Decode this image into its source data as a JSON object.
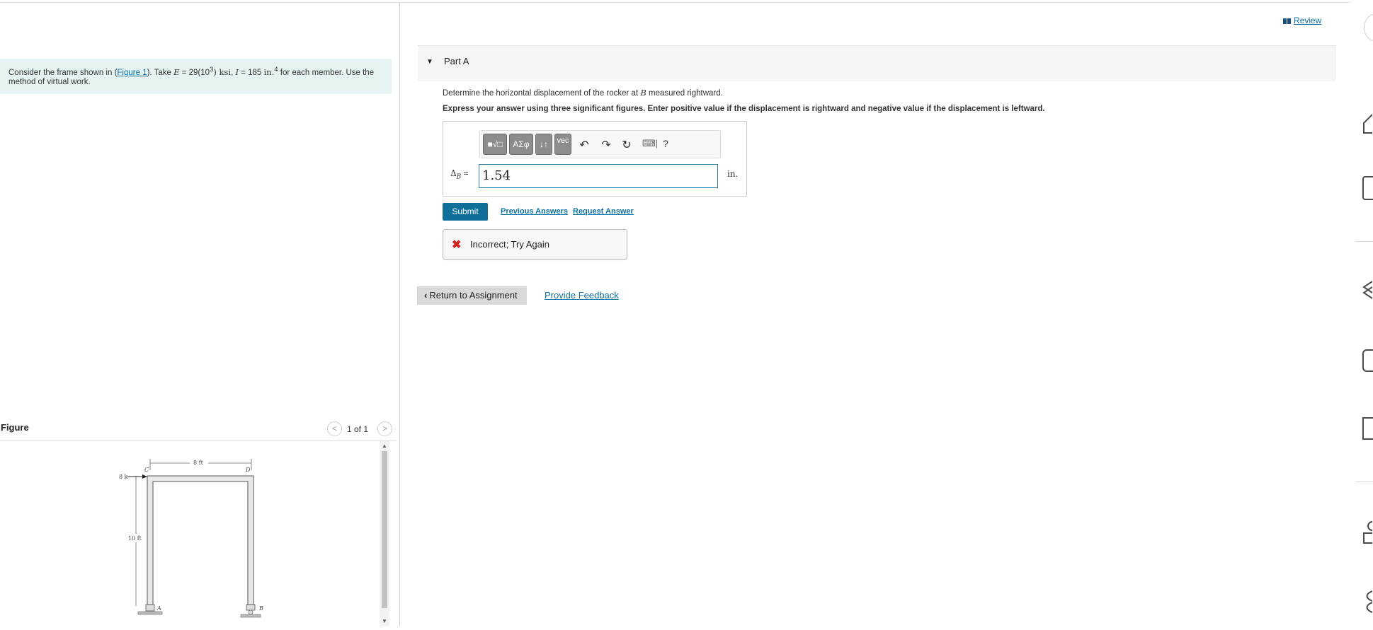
{
  "review": {
    "label": "Review"
  },
  "problem": {
    "prefix": "Consider the frame shown in (",
    "figure_link": "Figure 1",
    "middle": "). Take ",
    "e_symbol": "E",
    "e_value": " = 29(10",
    "e_exp": "3",
    "e_unit": ") ksi",
    "sep": ", ",
    "i_symbol": "I",
    "i_value": " = 185 ",
    "i_unit": "in.",
    "i_exp": "4",
    "suffix": " for each member. Use the method of virtual work."
  },
  "figure": {
    "title": "Figure",
    "pager": "1 of 1",
    "prev": "<",
    "next": ">",
    "labels": {
      "width": "8 ft",
      "height": "10 ft",
      "load": "8 k",
      "c": "C",
      "d": "D",
      "a": "A",
      "b": "B"
    }
  },
  "part": {
    "title": "Part A",
    "question_prefix": "Determine the horizontal displacement of the rocker at ",
    "question_point": "B",
    "question_suffix": " measured rightward.",
    "instruction": "Express your answer using three significant figures. Enter positive value if the displacement is rightward and negative value if the displacement is leftward."
  },
  "toolbar": {
    "templates": "■√□",
    "greek": "ΑΣφ",
    "arrows": "↓↑",
    "vec": "vec",
    "undo": "↶",
    "redo": "↷",
    "reset": "↻",
    "keyboard": "⌨|",
    "help": "?"
  },
  "answer": {
    "label": "Δ",
    "label_sub": "B",
    "eq": " =",
    "value": "1.54",
    "unit": "in."
  },
  "actions": {
    "submit": "Submit",
    "previous_answers": "Previous Answers",
    "request_answer": "Request Answer"
  },
  "feedback": {
    "icon": "✖",
    "text": "Incorrect; Try Again"
  },
  "footer": {
    "return": "Return to Assignment",
    "return_icon": "‹",
    "provide_feedback": "Provide Feedback"
  }
}
